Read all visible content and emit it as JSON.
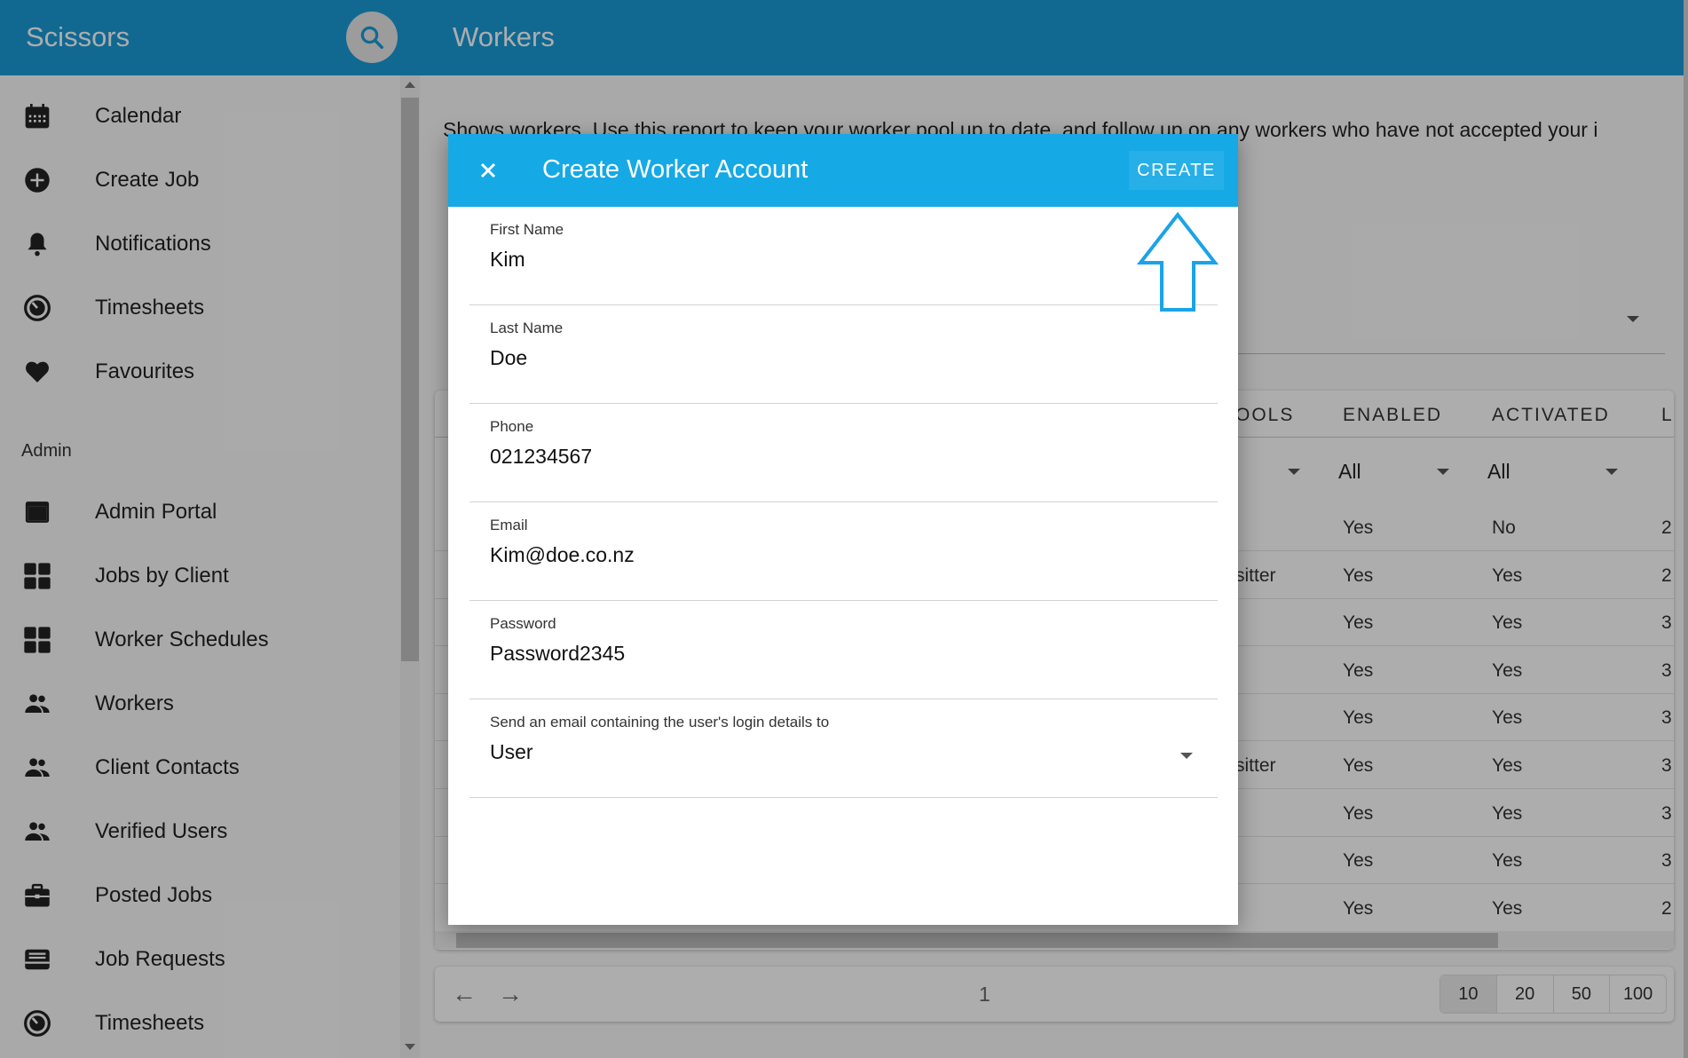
{
  "app": {
    "brand": "Scissors",
    "page_title": "Workers"
  },
  "sidebar": {
    "items": [
      {
        "label": "Calendar",
        "icon": "calendar-icon"
      },
      {
        "label": "Create Job",
        "icon": "add-circle-icon"
      },
      {
        "label": "Notifications",
        "icon": "bell-icon"
      },
      {
        "label": "Timesheets",
        "icon": "timer-icon"
      },
      {
        "label": "Favourites",
        "icon": "heart-icon"
      }
    ],
    "section_label": "Admin",
    "admin_items": [
      {
        "label": "Admin Portal",
        "icon": "window-icon"
      },
      {
        "label": "Jobs by Client",
        "icon": "grid-icon"
      },
      {
        "label": "Worker Schedules",
        "icon": "grid-icon"
      },
      {
        "label": "Workers",
        "icon": "people-icon"
      },
      {
        "label": "Client Contacts",
        "icon": "people-icon"
      },
      {
        "label": "Verified Users",
        "icon": "people-icon"
      },
      {
        "label": "Posted Jobs",
        "icon": "briefcase-icon"
      },
      {
        "label": "Job Requests",
        "icon": "inbox-icon"
      },
      {
        "label": "Timesheets",
        "icon": "timer-icon"
      }
    ]
  },
  "main": {
    "intro_text": "Shows workers. Use this report to keep your worker pool up to date, and follow up on any workers who have not accepted your i",
    "table": {
      "columns": [
        "OOLS",
        "ENABLED",
        "ACTIVATED",
        "L"
      ],
      "filters": {
        "enabled": "All",
        "activated": "All"
      },
      "rows": [
        {
          "pools": "",
          "enabled": "Yes",
          "activated": "No",
          "last": "2"
        },
        {
          "pools": "sitter",
          "enabled": "Yes",
          "activated": "Yes",
          "last": "2"
        },
        {
          "pools": "",
          "enabled": "Yes",
          "activated": "Yes",
          "last": "3"
        },
        {
          "pools": "",
          "enabled": "Yes",
          "activated": "Yes",
          "last": "3"
        },
        {
          "pools": "",
          "enabled": "Yes",
          "activated": "Yes",
          "last": "3"
        },
        {
          "pools": "sitter",
          "enabled": "Yes",
          "activated": "Yes",
          "last": "3"
        },
        {
          "pools": "",
          "enabled": "Yes",
          "activated": "Yes",
          "last": "3"
        },
        {
          "pools": "",
          "enabled": "Yes",
          "activated": "Yes",
          "last": "3"
        },
        {
          "pools": "",
          "enabled": "Yes",
          "activated": "Yes",
          "last": "2"
        }
      ]
    },
    "pager": {
      "prev": "←",
      "next": "→",
      "page": "1",
      "sizes": [
        "10",
        "20",
        "50",
        "100"
      ],
      "selected_size": "10"
    }
  },
  "dialog": {
    "title": "Create Worker Account",
    "create_label": "CREATE",
    "fields": [
      {
        "label": "First Name",
        "value": "Kim"
      },
      {
        "label": "Last Name",
        "value": "Doe"
      },
      {
        "label": "Phone",
        "value": "021234567"
      },
      {
        "label": "Email",
        "value": "Kim@doe.co.nz"
      },
      {
        "label": "Password",
        "value": "Password2345"
      },
      {
        "label": "Send an email containing the user's login details to",
        "value": "User"
      }
    ]
  },
  "colors": {
    "header": "#1a9bd7",
    "dialog_bar": "#15a9e6",
    "annotation": "#1aa3e8"
  }
}
